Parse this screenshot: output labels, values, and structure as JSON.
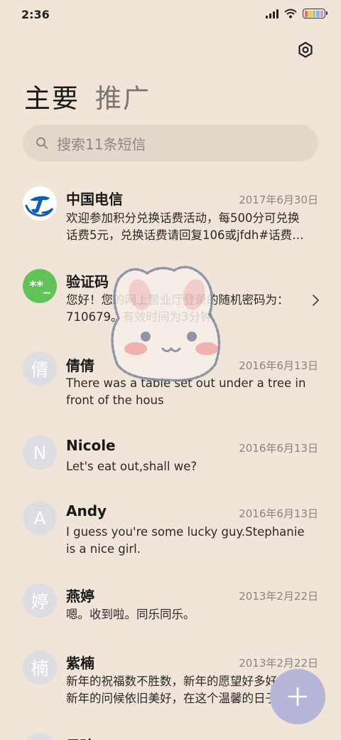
{
  "status_bar": {
    "time": "2:36",
    "icons": [
      "signal-icon",
      "wifi-icon",
      "battery-icon"
    ]
  },
  "header": {
    "settings_icon": "settings-icon",
    "tabs": [
      {
        "label": "主要",
        "active": true
      },
      {
        "label": "推广",
        "active": false
      }
    ]
  },
  "search": {
    "placeholder": "搜索11条短信",
    "icon": "search-icon"
  },
  "messages": [
    {
      "avatar_text": "",
      "avatar_type": "telecom-logo",
      "name": "中国电信",
      "date": "2017年6月30日",
      "line1": "欢迎参加积分兑换话费活动，每500分可兑换",
      "line2": "话费5元，兑换话费请回复106或jfdh#话费…"
    },
    {
      "avatar_text": "**_",
      "avatar_type": "green",
      "name": "验证码",
      "date": "",
      "line1": "您好！您的网上营业厅登录的随机密码为：",
      "line2": "710679。有效时间为3分钟"
    },
    {
      "avatar_text": "倩",
      "avatar_type": "gray",
      "name": "倩倩",
      "date": "2016年6月13日",
      "line1": "There was a table set out under a tree in",
      "line2": "front of the hous"
    },
    {
      "avatar_text": "N",
      "avatar_type": "gray",
      "name": "Nicole",
      "date": "2016年6月13日",
      "line1": "Let's eat out,shall we?",
      "line2": ""
    },
    {
      "avatar_text": "A",
      "avatar_type": "gray",
      "name": "Andy",
      "date": "2016年6月13日",
      "line1": "I guess you're some lucky guy.Stephanie",
      "line2": "is a nice girl."
    },
    {
      "avatar_text": "婷",
      "avatar_type": "gray",
      "name": "燕婷",
      "date": "2013年2月22日",
      "line1": "嗯。收到啦。同乐同乐。",
      "line2": ""
    },
    {
      "avatar_text": "楠",
      "avatar_type": "gray",
      "name": "紫楠",
      "date": "2013年2月22日",
      "line1": "新年的祝福数不胜数，新年的愿望好多好多，",
      "line2": "新年的问候依旧美好，在这个温馨的日子里"
    },
    {
      "avatar_text": "",
      "avatar_type": "gray",
      "name": "子玲",
      "date": "",
      "line1": "",
      "line2": ""
    }
  ],
  "fab": {
    "icon": "plus-icon"
  },
  "colors": {
    "background": "#f1e4d8",
    "search_bg": "#e4d8cc",
    "fab": "#b5b6d8",
    "verify_avatar": "#61c257",
    "telecom_blue": "#0f5bb5"
  }
}
